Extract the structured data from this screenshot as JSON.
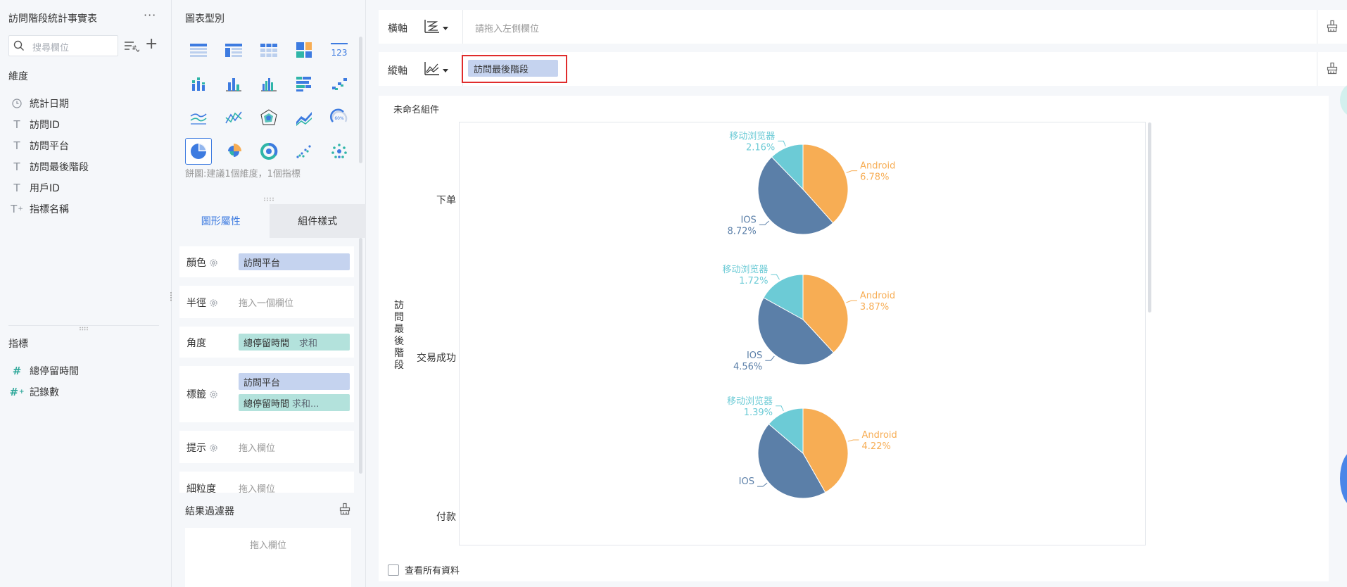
{
  "left": {
    "dataset_title": "訪問階段統計事實表",
    "more_label": "···",
    "search_placeholder": "搜尋欄位",
    "add_label": "+",
    "dimensions_label": "維度",
    "dimensions": [
      {
        "icon": "clock-icon",
        "glyph": "◷",
        "label": "統計日期"
      },
      {
        "icon": "text-field-icon",
        "glyph": "T",
        "label": "訪問ID"
      },
      {
        "icon": "text-field-icon",
        "glyph": "T",
        "label": "訪問平台"
      },
      {
        "icon": "text-field-icon",
        "glyph": "T",
        "label": "訪問最後階段"
      },
      {
        "icon": "text-field-icon",
        "glyph": "T",
        "label": "用戶ID"
      },
      {
        "icon": "text-field-icon",
        "glyph": "T",
        "label": "指標名稱"
      }
    ],
    "metrics_label": "指標",
    "metrics": [
      {
        "icon": "number-field-icon",
        "glyph": "#",
        "label": "總停留時間"
      },
      {
        "icon": "number-field-icon",
        "glyph": "#",
        "label": "記錄數"
      }
    ]
  },
  "mid": {
    "chart_type_title": "圖表型別",
    "chart_type_hint": "餅圖:建議1個維度，1個指標",
    "tabs": [
      "圖形屬性",
      "組件樣式"
    ],
    "props": {
      "color_label": "顏色",
      "color_chip": "訪問平台",
      "radius_label": "半徑",
      "radius_placeholder": "拖入一個欄位",
      "angle_label": "角度",
      "angle_chip": "總停留時間",
      "angle_agg": "求和",
      "label_label": "標籤",
      "label_chip1": "訪問平台",
      "label_chip2": "總停留時間",
      "label_chip2_agg": "求和...",
      "tooltip_label": "提示",
      "tooltip_placeholder": "拖入欄位",
      "granularity_label": "細粒度",
      "granularity_placeholder": "拖入欄位"
    },
    "filter_title": "結果過濾器",
    "filter_placeholder": "拖入欄位"
  },
  "right": {
    "x_axis_label": "橫軸",
    "x_axis_placeholder": "請拖入左側欄位",
    "y_axis_label": "縱軸",
    "y_axis_chip": "訪問最後階段",
    "widget_title": "未命名組件",
    "y_title": "訪問最後階段",
    "view_all_label": "查看所有資料"
  },
  "colors": {
    "android": "#f7ad54",
    "ios": "#5b7fa8",
    "browser": "#6ccbd6",
    "accent": "#3d7be0",
    "highlight": "#e02c2c"
  },
  "chart_data": {
    "type": "pie",
    "categories": [
      "下单",
      "交易成功",
      "付款"
    ],
    "pies": [
      {
        "category": "下单",
        "slices": [
          {
            "name": "Android",
            "percent": "6.78%",
            "value": 6.78
          },
          {
            "name": "IOS",
            "percent": "8.72%",
            "value": 8.72
          },
          {
            "name": "移动浏览器",
            "percent": "2.16%",
            "value": 2.16
          }
        ]
      },
      {
        "category": "交易成功",
        "slices": [
          {
            "name": "Android",
            "percent": "3.87%",
            "value": 3.87
          },
          {
            "name": "IOS",
            "percent": "4.56%",
            "value": 4.56
          },
          {
            "name": "移动浏览器",
            "percent": "1.72%",
            "value": 1.72
          }
        ]
      },
      {
        "category": "付款",
        "slices": [
          {
            "name": "Android",
            "percent": "4.22%",
            "value": 4.22
          },
          {
            "name": "IOS",
            "percent": "",
            "value": 4.5
          },
          {
            "name": "移动浏览器",
            "percent": "1.39%",
            "value": 1.39
          }
        ]
      }
    ]
  }
}
